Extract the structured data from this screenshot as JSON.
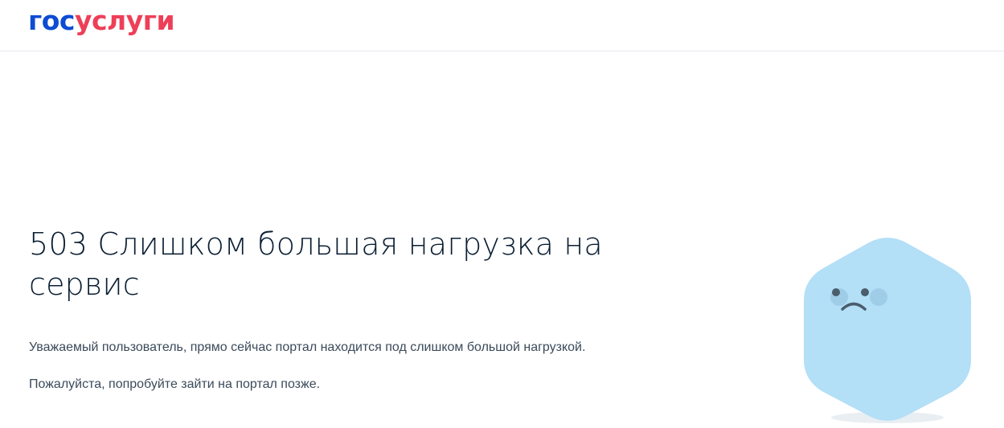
{
  "colors": {
    "logo_blue": "#0d4cd3",
    "logo_red": "#ee3f58",
    "mascot_body": "#b3dff7"
  },
  "header": {
    "logo_part_a": "гос",
    "logo_part_b": "услуги"
  },
  "error": {
    "title": "503 Слишком большая нагрузка на сервис",
    "paragraph_1": "Уважаемый пользователь, прямо сейчас портал находится под слишком большой нагрузкой.",
    "paragraph_2": "Пожалуйста, попробуйте зайти на портал позже."
  },
  "illustration": {
    "icon": "sad-hexagon-mascot-icon"
  }
}
